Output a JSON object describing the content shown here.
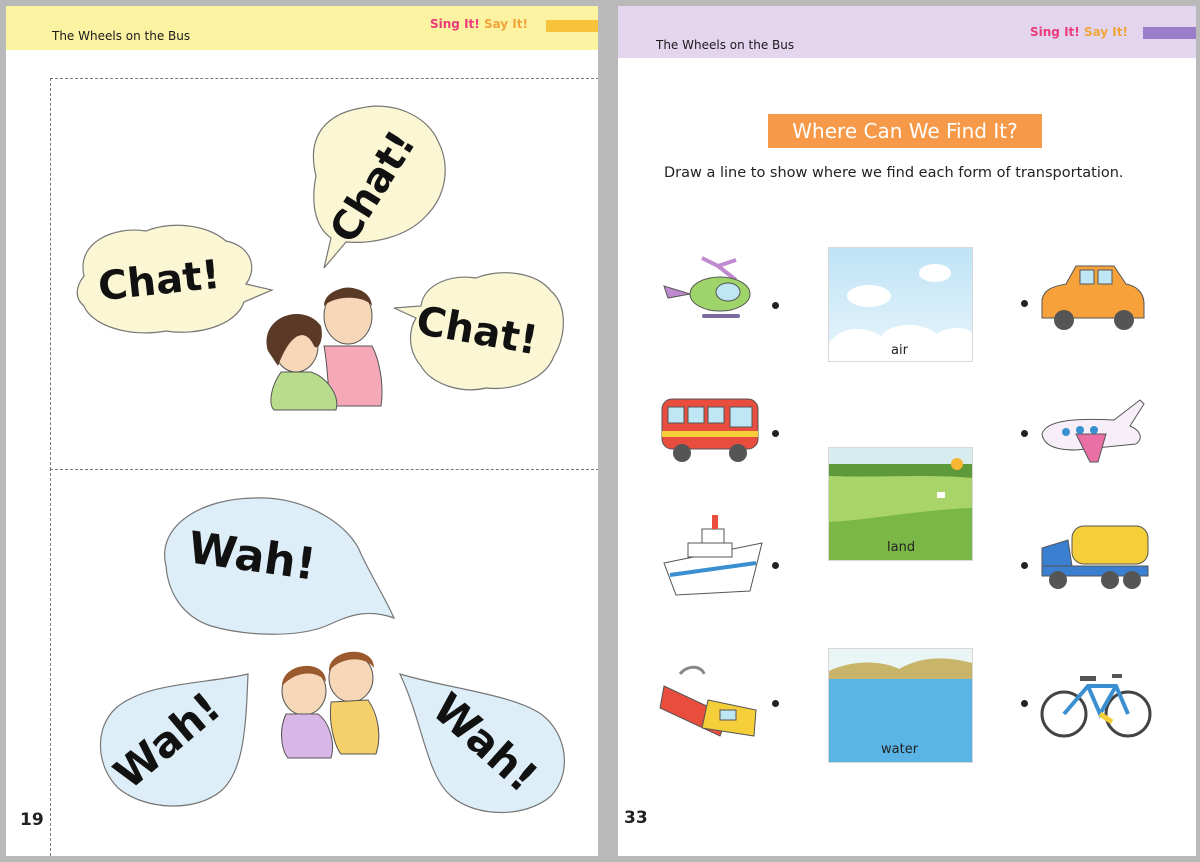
{
  "left_page": {
    "header_title": "The Wheels on the Bus",
    "brand_sing": "Sing It!",
    "brand_say": "Say It!",
    "page_number": "19",
    "top_panel": {
      "bubbles": [
        "Chat!",
        "Chat!",
        "Chat!"
      ]
    },
    "bottom_panel": {
      "bubbles": [
        "Wah!",
        "Wah!",
        "Wah!"
      ]
    }
  },
  "right_page": {
    "header_title": "The Wheels on the Bus",
    "brand_sing": "Sing It!",
    "brand_say": "Say It!",
    "page_number": "33",
    "activity_title": "Where Can We Find It?",
    "instructions": "Draw a line to show where we find each form of transportation.",
    "scenes": [
      "air",
      "land",
      "water"
    ],
    "left_vehicles": [
      "helicopter",
      "bus",
      "ship",
      "train"
    ],
    "right_vehicles": [
      "car",
      "airplane",
      "truck",
      "bicycle"
    ]
  },
  "colors": {
    "left_header": "#fbf3a2",
    "right_header": "#e4d5ef",
    "title_box": "#f69a4a",
    "chat_bubble": "#fbf6d4",
    "wah_bubble": "#ddeef8"
  }
}
